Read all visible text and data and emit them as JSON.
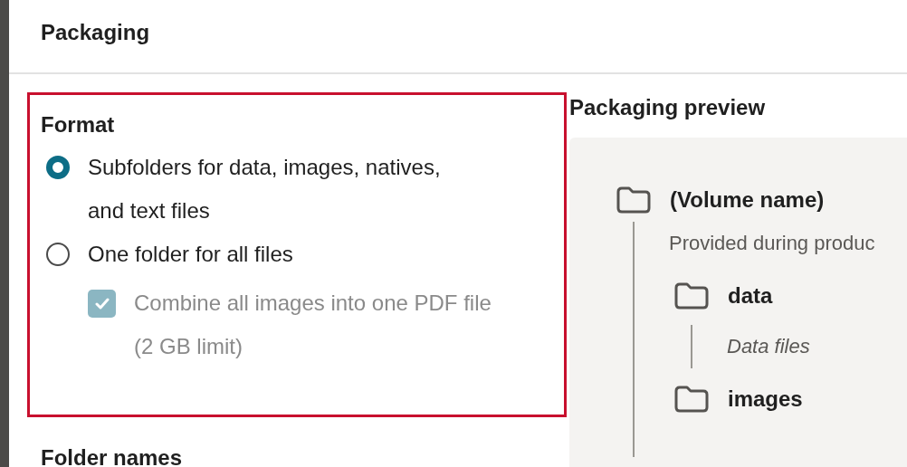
{
  "header": {
    "title": "Packaging"
  },
  "format": {
    "title": "Format",
    "options": [
      {
        "label": "Subfolders for data, images, natives, and text files",
        "selected": true
      },
      {
        "label": "One folder for all files",
        "selected": false
      }
    ],
    "combine": {
      "label": "Combine all images into one PDF file (2 GB limit)",
      "checked": true,
      "disabled": true
    }
  },
  "folder_names": {
    "title": "Folder names"
  },
  "preview": {
    "title": "Packaging preview",
    "tree": [
      {
        "name": "(Volume name)",
        "description": "Provided during produc",
        "children": [
          {
            "name": "data",
            "description": "Data files"
          },
          {
            "name": "images"
          }
        ]
      }
    ]
  }
}
